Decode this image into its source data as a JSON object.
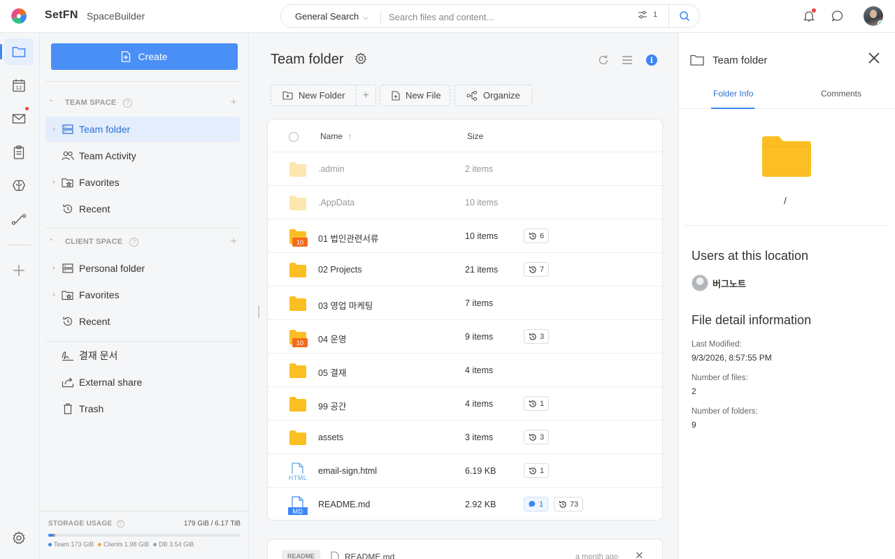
{
  "header": {
    "brand": "SetFN",
    "product": "SpaceBuilder",
    "search_scope": "General Search",
    "search_placeholder": "Search files and content...",
    "filter_count": "1"
  },
  "sidebar": {
    "create_label": "Create",
    "team_space": {
      "title": "TEAM SPACE",
      "items": [
        {
          "label": "Team folder",
          "icon": "server-icon",
          "active": true
        },
        {
          "label": "Team Activity",
          "icon": "users-icon"
        },
        {
          "label": "Favorites",
          "icon": "star-folder-icon"
        },
        {
          "label": "Recent",
          "icon": "history-icon"
        }
      ]
    },
    "client_space": {
      "title": "CLIENT SPACE",
      "items": [
        {
          "label": "Personal folder",
          "icon": "server-icon"
        },
        {
          "label": "Favorites",
          "icon": "star-folder-icon"
        },
        {
          "label": "Recent",
          "icon": "history-icon"
        }
      ]
    },
    "extra_items": [
      {
        "label": "결재 문서",
        "icon": "signature-icon"
      },
      {
        "label": "External share",
        "icon": "share-icon"
      },
      {
        "label": "Trash",
        "icon": "trash-icon"
      }
    ],
    "storage": {
      "title": "STORAGE USAGE",
      "total": "179 GiB / 6.17 TiB",
      "legend": [
        {
          "label": "Team 173 GiB",
          "color": "#3d86f5",
          "fraction": 0.0274
        },
        {
          "label": "Clients 1.98 GiB",
          "color": "#f5a14a",
          "fraction": 0.004
        },
        {
          "label": "DB 3.54 GiB",
          "color": "#9aa1a8",
          "fraction": 0.004
        }
      ]
    }
  },
  "main": {
    "title": "Team folder",
    "buttons": {
      "new_folder": "New Folder",
      "new_file": "New File",
      "organize": "Organize"
    },
    "columns": {
      "name": "Name",
      "size": "Size"
    },
    "files": [
      {
        "name": ".admin",
        "size": "2 items",
        "type": "folder",
        "dim": true
      },
      {
        "name": ".AppData",
        "size": "10 items",
        "type": "folder",
        "dim": true
      },
      {
        "name": "01 법인관련서류",
        "size": "10 items",
        "type": "folder-badge",
        "folder_badge": "10",
        "history": "6"
      },
      {
        "name": "02 Projects",
        "size": "21 items",
        "type": "folder",
        "history": "7"
      },
      {
        "name": "03 영업 마케팅",
        "size": "7 items",
        "type": "folder"
      },
      {
        "name": "04 운영",
        "size": "9 items",
        "type": "folder-badge",
        "folder_badge": "10",
        "history": "3"
      },
      {
        "name": "05 결재",
        "size": "4 items",
        "type": "folder"
      },
      {
        "name": "99 공간",
        "size": "4 items",
        "type": "folder",
        "history": "1"
      },
      {
        "name": "assets",
        "size": "3 items",
        "type": "folder",
        "history": "3"
      },
      {
        "name": "email-sign.html",
        "size": "6.19 KB",
        "type": "html",
        "file_tag": "HTML",
        "history": "1"
      },
      {
        "name": "README.md",
        "size": "2.92 KB",
        "type": "md",
        "file_tag": "MD",
        "comments": "1",
        "history": "73"
      }
    ],
    "readme": {
      "tag": "README",
      "name": "README.md",
      "time": "a month ago"
    }
  },
  "panel": {
    "title": "Team folder",
    "tabs": [
      "Folder Info",
      "Comments"
    ],
    "path": "/",
    "users_heading": "Users at this location",
    "user_name": "버그노트",
    "detail_heading": "File detail information",
    "details": [
      {
        "label": "Last Modified:",
        "value": "9/3/2026, 8:57:55 PM"
      },
      {
        "label": "Number of files:",
        "value": "2"
      },
      {
        "label": "Number of folders:",
        "value": "9"
      }
    ]
  },
  "colors": {
    "accent": "#3d86f5",
    "folder": "#fbbf24",
    "folder_dim": "#fde7b0",
    "folder_badge": "#f26b1d",
    "alert": "#f04438"
  }
}
